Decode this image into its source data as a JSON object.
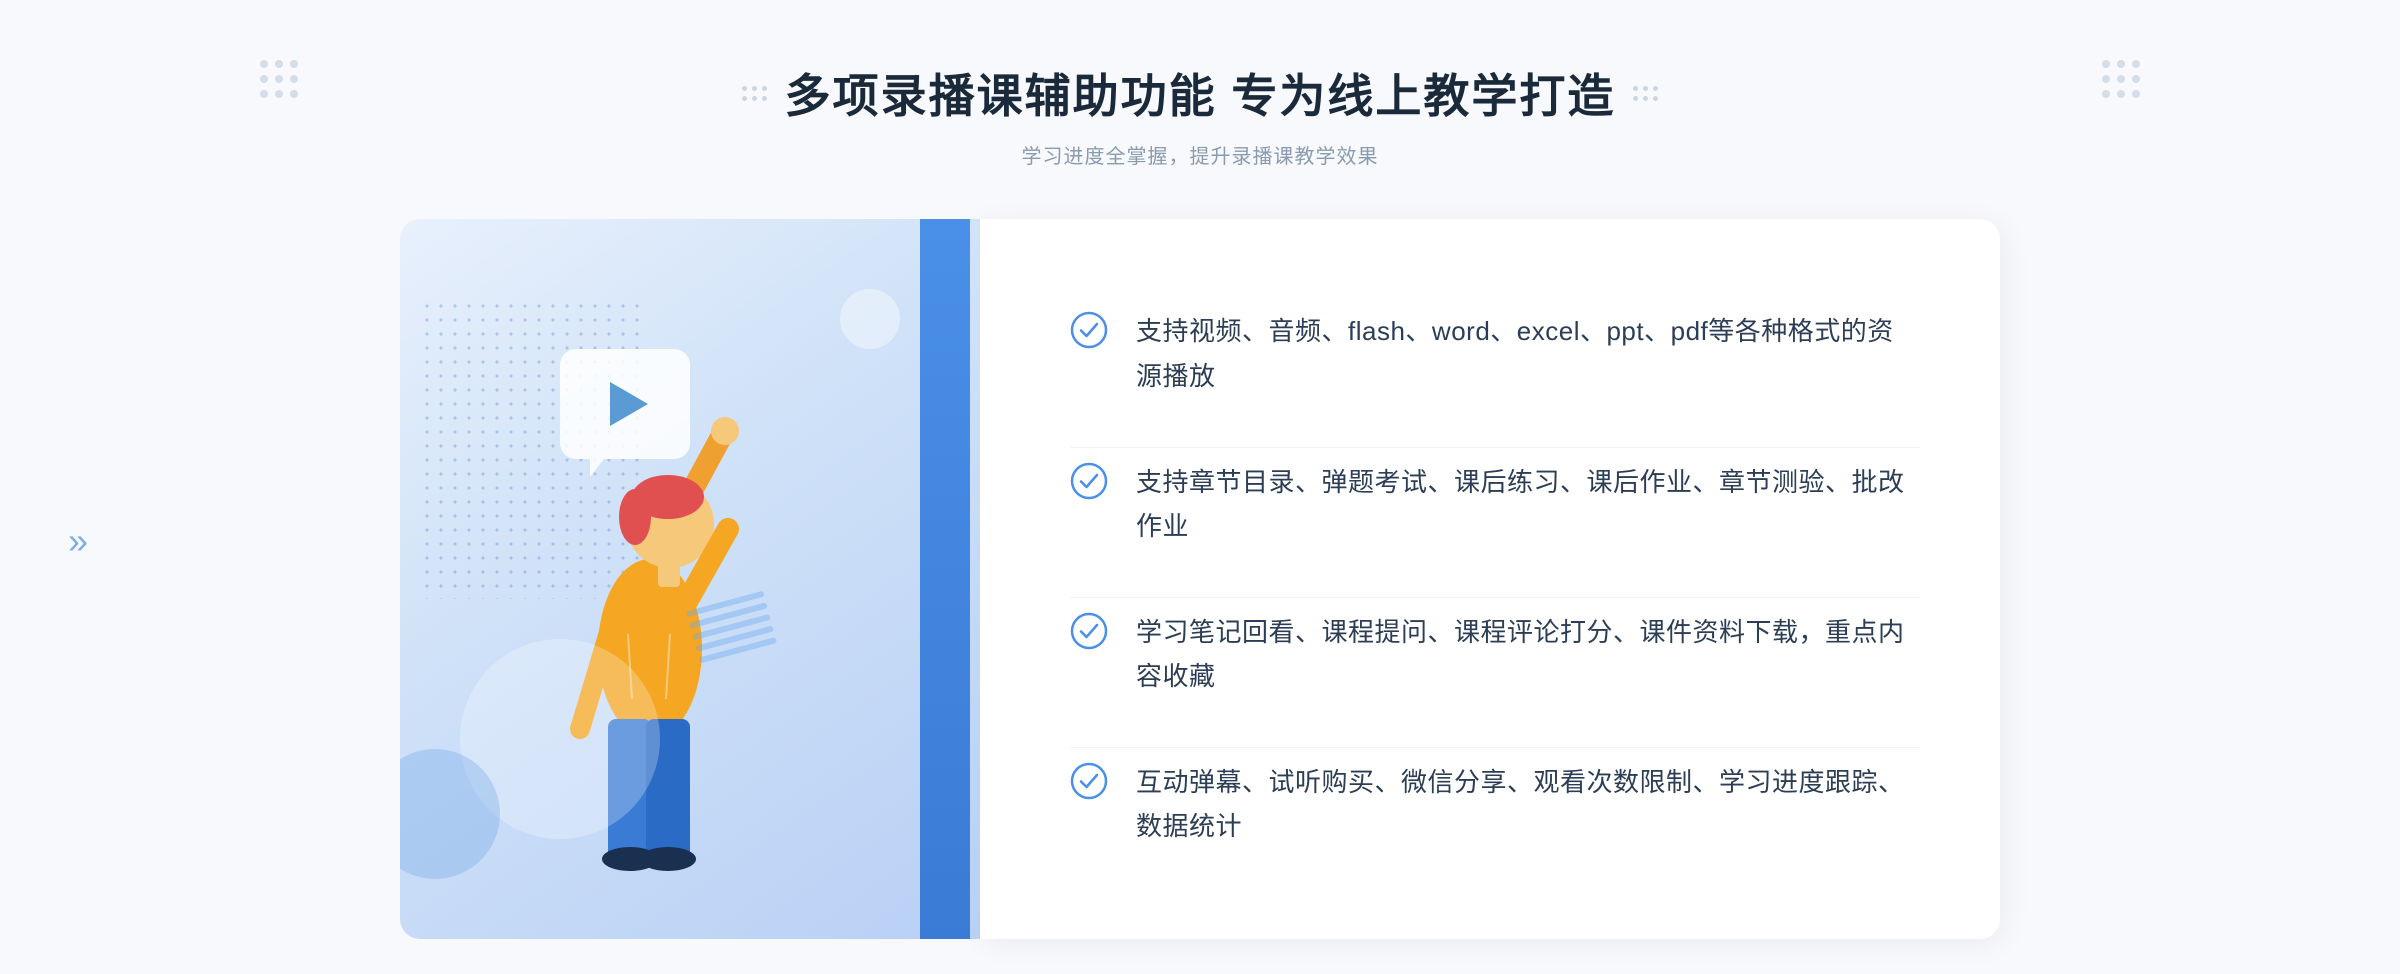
{
  "header": {
    "title": "多项录播课辅助功能 专为线上教学打造",
    "subtitle": "学习进度全掌握，提升录播课教学效果"
  },
  "features": [
    {
      "id": 1,
      "text": "支持视频、音频、flash、word、excel、ppt、pdf等各种格式的资源播放"
    },
    {
      "id": 2,
      "text": "支持章节目录、弹题考试、课后练习、课后作业、章节测验、批改作业"
    },
    {
      "id": 3,
      "text": "学习笔记回看、课程提问、课程评论打分、课件资料下载，重点内容收藏"
    },
    {
      "id": 4,
      "text": "互动弹幕、试听购买、微信分享、观看次数限制、学习进度跟踪、数据统计"
    }
  ],
  "icons": {
    "check": "check-circle-icon",
    "play": "play-icon",
    "chevron_left": "«",
    "chevron_right": "»"
  },
  "colors": {
    "accent_blue": "#4a8fe8",
    "text_dark": "#2c3e55",
    "text_gray": "#8a9bb0",
    "bg_light": "#f8f9fc",
    "check_color": "#4a8fe8"
  }
}
